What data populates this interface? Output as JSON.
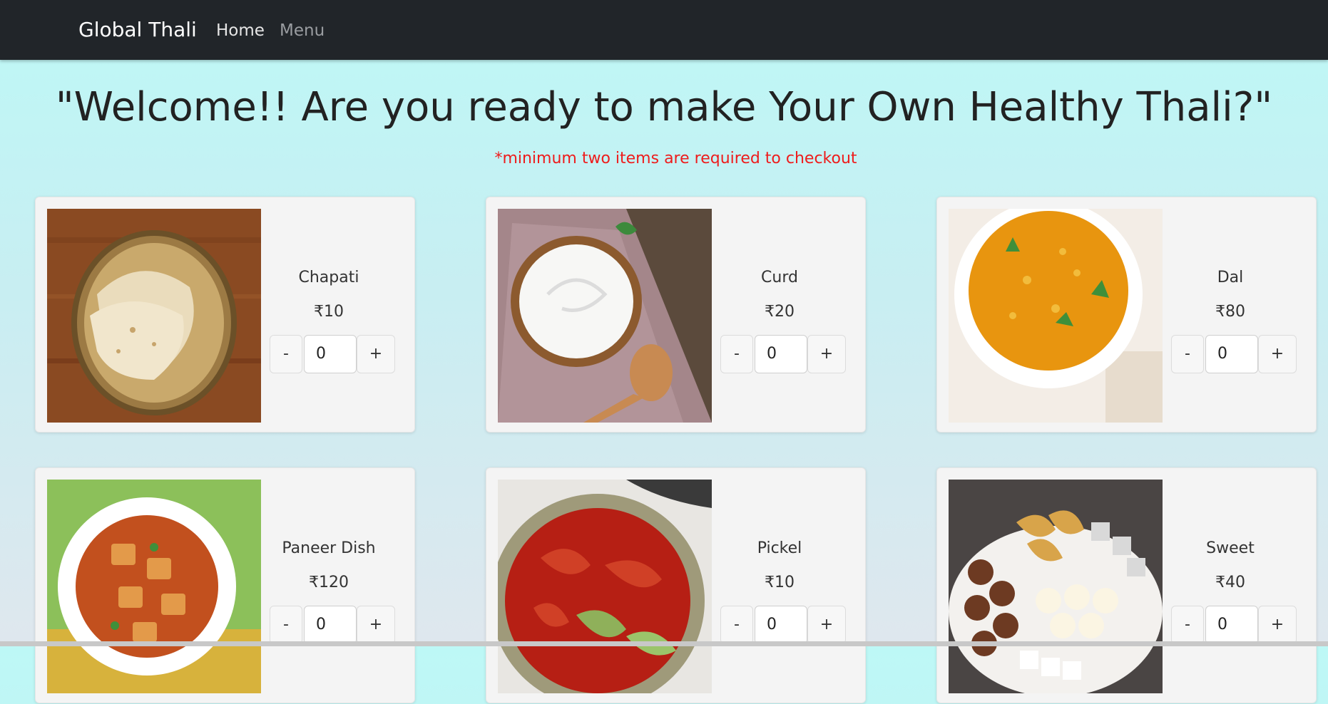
{
  "navbar": {
    "brand": "Global Thali",
    "links": [
      {
        "label": "Home",
        "active": true
      },
      {
        "label": "Menu",
        "active": false
      }
    ]
  },
  "hero": {
    "title": "\"Welcome!! Are you ready to make Your Own Healthy Thali?\"",
    "note": "*minimum two items are required to checkout"
  },
  "items": [
    {
      "name": "Chapati",
      "price": "₹10",
      "qty": "0",
      "minus": "-",
      "plus": "+",
      "image": "chapati-image"
    },
    {
      "name": "Curd",
      "price": "₹20",
      "qty": "0",
      "minus": "-",
      "plus": "+",
      "image": "curd-image"
    },
    {
      "name": "Dal",
      "price": "₹80",
      "qty": "0",
      "minus": "-",
      "plus": "+",
      "image": "dal-image"
    },
    {
      "name": "Paneer Dish",
      "price": "₹120",
      "qty": "0",
      "minus": "-",
      "plus": "+",
      "image": "paneer-image"
    },
    {
      "name": "Pickel",
      "price": "₹10",
      "qty": "0",
      "minus": "-",
      "plus": "+",
      "image": "pickle-image"
    },
    {
      "name": "Sweet",
      "price": "₹40",
      "qty": "0",
      "minus": "-",
      "plus": "+",
      "image": "sweet-image"
    }
  ],
  "colors": {
    "navbar": "#212529",
    "note": "#ee1c1c",
    "card": "#f4f4f4"
  }
}
